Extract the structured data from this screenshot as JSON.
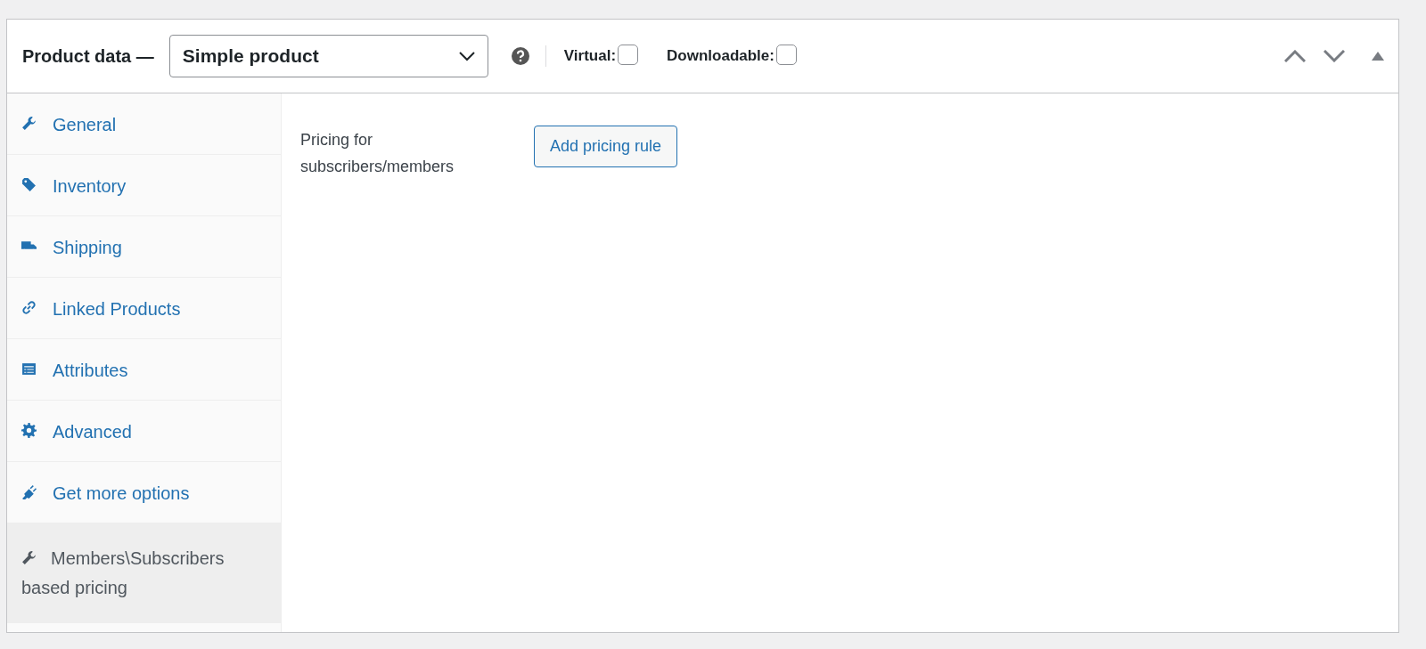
{
  "panel": {
    "title": "Product data —",
    "product_type": {
      "value": "Simple product"
    },
    "options": [
      {
        "label": "Virtual:",
        "checked": false
      },
      {
        "label": "Downloadable:",
        "checked": false
      }
    ]
  },
  "tabs": [
    {
      "label": "General",
      "kind": "wrench",
      "selected": false
    },
    {
      "label": "Inventory",
      "kind": "tag",
      "selected": false
    },
    {
      "label": "Shipping",
      "kind": "truck",
      "selected": false
    },
    {
      "label": "Linked Products",
      "kind": "link",
      "selected": false
    },
    {
      "label": "Attributes",
      "kind": "list",
      "selected": false
    },
    {
      "label": "Advanced",
      "kind": "gear",
      "selected": false
    },
    {
      "label": "Get more options",
      "kind": "plug",
      "selected": false
    },
    {
      "label": "Members\\Subscribers based pricing",
      "kind": "wrench",
      "selected": true
    }
  ],
  "content": {
    "label": "Pricing for subscribers/members",
    "button": "Add pricing rule"
  }
}
